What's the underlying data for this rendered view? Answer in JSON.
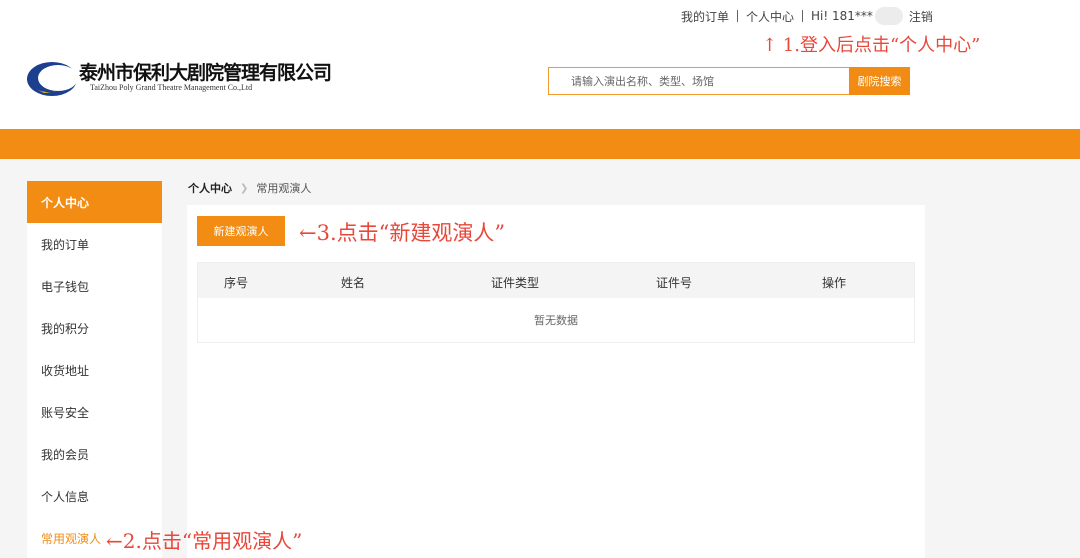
{
  "topnav": {
    "my_orders": "我的订单",
    "personal_center": "个人中心",
    "greeting": "Hi! 181***",
    "logout": "注销"
  },
  "annotations": {
    "step1": "↑ 1.登入后点击“个人中心”",
    "step2": "←2.点击“常用观演人”",
    "step3": "←3.点击“新建观演人”"
  },
  "logo": {
    "name_cn": "泰州市保利大剧院管理有限公司",
    "name_en": "TaiZhou Poly Grand Theatre Management Co.,Ltd"
  },
  "search": {
    "placeholder": "请输入演出名称、类型、场馆",
    "button": "剧院搜索"
  },
  "sidebar": {
    "header": "个人中心",
    "items": [
      {
        "label": "我的订单"
      },
      {
        "label": "电子钱包"
      },
      {
        "label": "我的积分"
      },
      {
        "label": "收货地址"
      },
      {
        "label": "账号安全"
      },
      {
        "label": "我的会员"
      },
      {
        "label": "个人信息"
      },
      {
        "label": "常用观演人",
        "active": true
      }
    ]
  },
  "breadcrumb": {
    "root": "个人中心",
    "current": "常用观演人"
  },
  "main": {
    "new_button": "新建观演人",
    "table": {
      "columns": [
        "序号",
        "姓名",
        "证件类型",
        "证件号",
        "操作"
      ],
      "rows": [],
      "empty_text": "暂无数据"
    }
  },
  "colors": {
    "brand_orange": "#f38c13",
    "annotation_red": "#e8473a"
  }
}
